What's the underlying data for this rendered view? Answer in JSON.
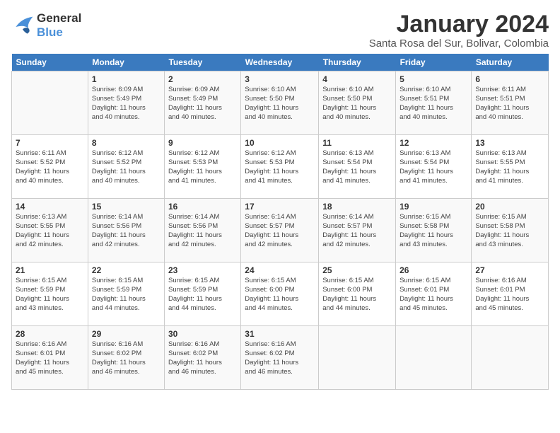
{
  "header": {
    "logo_line1": "General",
    "logo_line2": "Blue",
    "month_title": "January 2024",
    "subtitle": "Santa Rosa del Sur, Bolivar, Colombia"
  },
  "weekdays": [
    "Sunday",
    "Monday",
    "Tuesday",
    "Wednesday",
    "Thursday",
    "Friday",
    "Saturday"
  ],
  "weeks": [
    [
      {
        "day": "",
        "info": ""
      },
      {
        "day": "1",
        "info": "Sunrise: 6:09 AM\nSunset: 5:49 PM\nDaylight: 11 hours\nand 40 minutes."
      },
      {
        "day": "2",
        "info": "Sunrise: 6:09 AM\nSunset: 5:49 PM\nDaylight: 11 hours\nand 40 minutes."
      },
      {
        "day": "3",
        "info": "Sunrise: 6:10 AM\nSunset: 5:50 PM\nDaylight: 11 hours\nand 40 minutes."
      },
      {
        "day": "4",
        "info": "Sunrise: 6:10 AM\nSunset: 5:50 PM\nDaylight: 11 hours\nand 40 minutes."
      },
      {
        "day": "5",
        "info": "Sunrise: 6:10 AM\nSunset: 5:51 PM\nDaylight: 11 hours\nand 40 minutes."
      },
      {
        "day": "6",
        "info": "Sunrise: 6:11 AM\nSunset: 5:51 PM\nDaylight: 11 hours\nand 40 minutes."
      }
    ],
    [
      {
        "day": "7",
        "info": "Sunrise: 6:11 AM\nSunset: 5:52 PM\nDaylight: 11 hours\nand 40 minutes."
      },
      {
        "day": "8",
        "info": "Sunrise: 6:12 AM\nSunset: 5:52 PM\nDaylight: 11 hours\nand 40 minutes."
      },
      {
        "day": "9",
        "info": "Sunrise: 6:12 AM\nSunset: 5:53 PM\nDaylight: 11 hours\nand 41 minutes."
      },
      {
        "day": "10",
        "info": "Sunrise: 6:12 AM\nSunset: 5:53 PM\nDaylight: 11 hours\nand 41 minutes."
      },
      {
        "day": "11",
        "info": "Sunrise: 6:13 AM\nSunset: 5:54 PM\nDaylight: 11 hours\nand 41 minutes."
      },
      {
        "day": "12",
        "info": "Sunrise: 6:13 AM\nSunset: 5:54 PM\nDaylight: 11 hours\nand 41 minutes."
      },
      {
        "day": "13",
        "info": "Sunrise: 6:13 AM\nSunset: 5:55 PM\nDaylight: 11 hours\nand 41 minutes."
      }
    ],
    [
      {
        "day": "14",
        "info": "Sunrise: 6:13 AM\nSunset: 5:55 PM\nDaylight: 11 hours\nand 42 minutes."
      },
      {
        "day": "15",
        "info": "Sunrise: 6:14 AM\nSunset: 5:56 PM\nDaylight: 11 hours\nand 42 minutes."
      },
      {
        "day": "16",
        "info": "Sunrise: 6:14 AM\nSunset: 5:56 PM\nDaylight: 11 hours\nand 42 minutes."
      },
      {
        "day": "17",
        "info": "Sunrise: 6:14 AM\nSunset: 5:57 PM\nDaylight: 11 hours\nand 42 minutes."
      },
      {
        "day": "18",
        "info": "Sunrise: 6:14 AM\nSunset: 5:57 PM\nDaylight: 11 hours\nand 42 minutes."
      },
      {
        "day": "19",
        "info": "Sunrise: 6:15 AM\nSunset: 5:58 PM\nDaylight: 11 hours\nand 43 minutes."
      },
      {
        "day": "20",
        "info": "Sunrise: 6:15 AM\nSunset: 5:58 PM\nDaylight: 11 hours\nand 43 minutes."
      }
    ],
    [
      {
        "day": "21",
        "info": "Sunrise: 6:15 AM\nSunset: 5:59 PM\nDaylight: 11 hours\nand 43 minutes."
      },
      {
        "day": "22",
        "info": "Sunrise: 6:15 AM\nSunset: 5:59 PM\nDaylight: 11 hours\nand 44 minutes."
      },
      {
        "day": "23",
        "info": "Sunrise: 6:15 AM\nSunset: 5:59 PM\nDaylight: 11 hours\nand 44 minutes."
      },
      {
        "day": "24",
        "info": "Sunrise: 6:15 AM\nSunset: 6:00 PM\nDaylight: 11 hours\nand 44 minutes."
      },
      {
        "day": "25",
        "info": "Sunrise: 6:15 AM\nSunset: 6:00 PM\nDaylight: 11 hours\nand 44 minutes."
      },
      {
        "day": "26",
        "info": "Sunrise: 6:15 AM\nSunset: 6:01 PM\nDaylight: 11 hours\nand 45 minutes."
      },
      {
        "day": "27",
        "info": "Sunrise: 6:16 AM\nSunset: 6:01 PM\nDaylight: 11 hours\nand 45 minutes."
      }
    ],
    [
      {
        "day": "28",
        "info": "Sunrise: 6:16 AM\nSunset: 6:01 PM\nDaylight: 11 hours\nand 45 minutes."
      },
      {
        "day": "29",
        "info": "Sunrise: 6:16 AM\nSunset: 6:02 PM\nDaylight: 11 hours\nand 46 minutes."
      },
      {
        "day": "30",
        "info": "Sunrise: 6:16 AM\nSunset: 6:02 PM\nDaylight: 11 hours\nand 46 minutes."
      },
      {
        "day": "31",
        "info": "Sunrise: 6:16 AM\nSunset: 6:02 PM\nDaylight: 11 hours\nand 46 minutes."
      },
      {
        "day": "",
        "info": ""
      },
      {
        "day": "",
        "info": ""
      },
      {
        "day": "",
        "info": ""
      }
    ]
  ]
}
